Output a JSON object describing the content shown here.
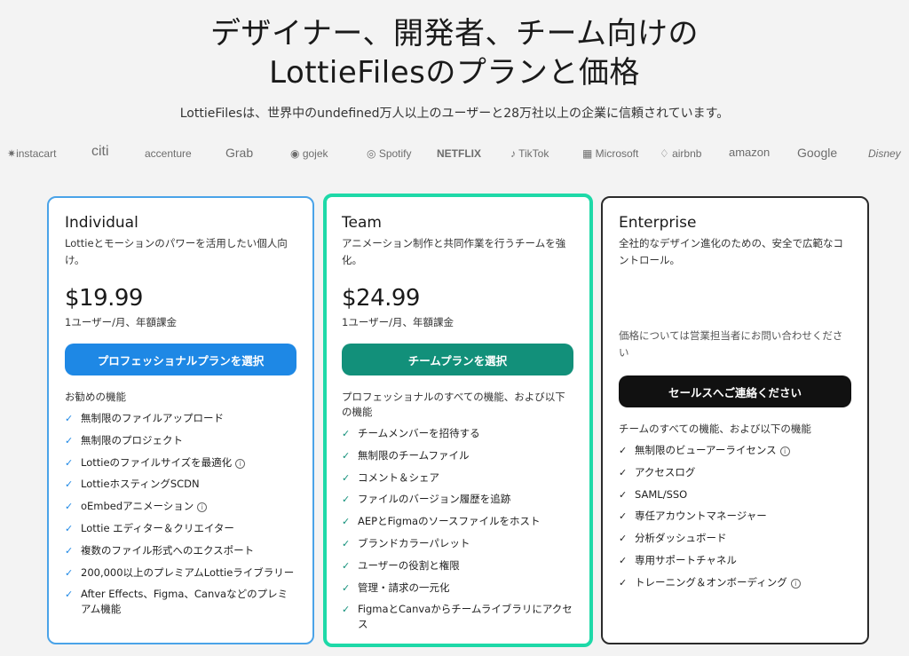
{
  "hero": {
    "title_line1": "デザイナー、開発者、チーム向けの",
    "title_line2": "LottieFilesのプランと価格",
    "subtitle": "LottieFilesは、世界中のundefined万人以上のユーザーと28万社以上の企業に信頼されています。"
  },
  "logos": [
    "instacart",
    "citi",
    "accenture",
    "Grab",
    "gojek",
    "Spotify",
    "NETFLIX",
    "TikTok",
    "Microsoft",
    "airbnb",
    "amazon",
    "Google",
    "Disney"
  ],
  "plans": {
    "individual": {
      "name": "Individual",
      "description": "Lottieとモーションのパワーを活用したい個人向け。",
      "price": "$19.99",
      "price_note": "1ユーザー/月、年額課金",
      "cta": "プロフェッショナルプランを選択",
      "features_heading": "お勧めの機能",
      "features": [
        "無制限のファイルアップロード",
        "無制限のプロジェクト",
        "Lottieのファイルサイズを最適化",
        "LottieホスティングSCDN",
        "oEmbedアニメーション",
        "Lottie エディター＆クリエイター",
        "複数のファイル形式へのエクスポート",
        "200,000以上のプレミアムLottieライブラリー",
        "After Effects、Figma、Canvaなどのプレミアム機能"
      ]
    },
    "team": {
      "name": "Team",
      "description": "アニメーション制作と共同作業を行うチームを強化。",
      "price": "$24.99",
      "price_note": "1ユーザー/月、年額課金",
      "cta": "チームプランを選択",
      "features_heading": "プロフェッショナルのすべての機能、および以下の機能",
      "features": [
        "チームメンバーを招待する",
        "無制限のチームファイル",
        "コメント＆シェア",
        "ファイルのバージョン履歴を追跡",
        "AEPとFigmaのソースファイルをホスト",
        "ブランドカラーパレット",
        "ユーザーの役割と権限",
        "管理・請求の一元化",
        "FigmaとCanvaからチームライブラリにアクセス"
      ]
    },
    "enterprise": {
      "name": "Enterprise",
      "description": "全社的なデザイン進化のための、安全で広範なコントロール。",
      "contact_note": "価格については営業担当者にお問い合わせください",
      "cta": "セールスへご連絡ください",
      "features_heading": "チームのすべての機能、および以下の機能",
      "features": [
        "無制限のビューアーライセンス",
        "アクセスログ",
        "SAML/SSO",
        "専任アカウントマネージャー",
        "分析ダッシュボード",
        "専用サポートチャネル",
        "トレーニング＆オンボーディング"
      ]
    }
  },
  "colors": {
    "individual_border": "#4aa3e8",
    "team_border": "#1ed9a8",
    "enterprise_border": "#2b2b2b",
    "individual_cta": "#1e88e5",
    "team_cta": "#12907a",
    "enterprise_cta": "#111111"
  }
}
